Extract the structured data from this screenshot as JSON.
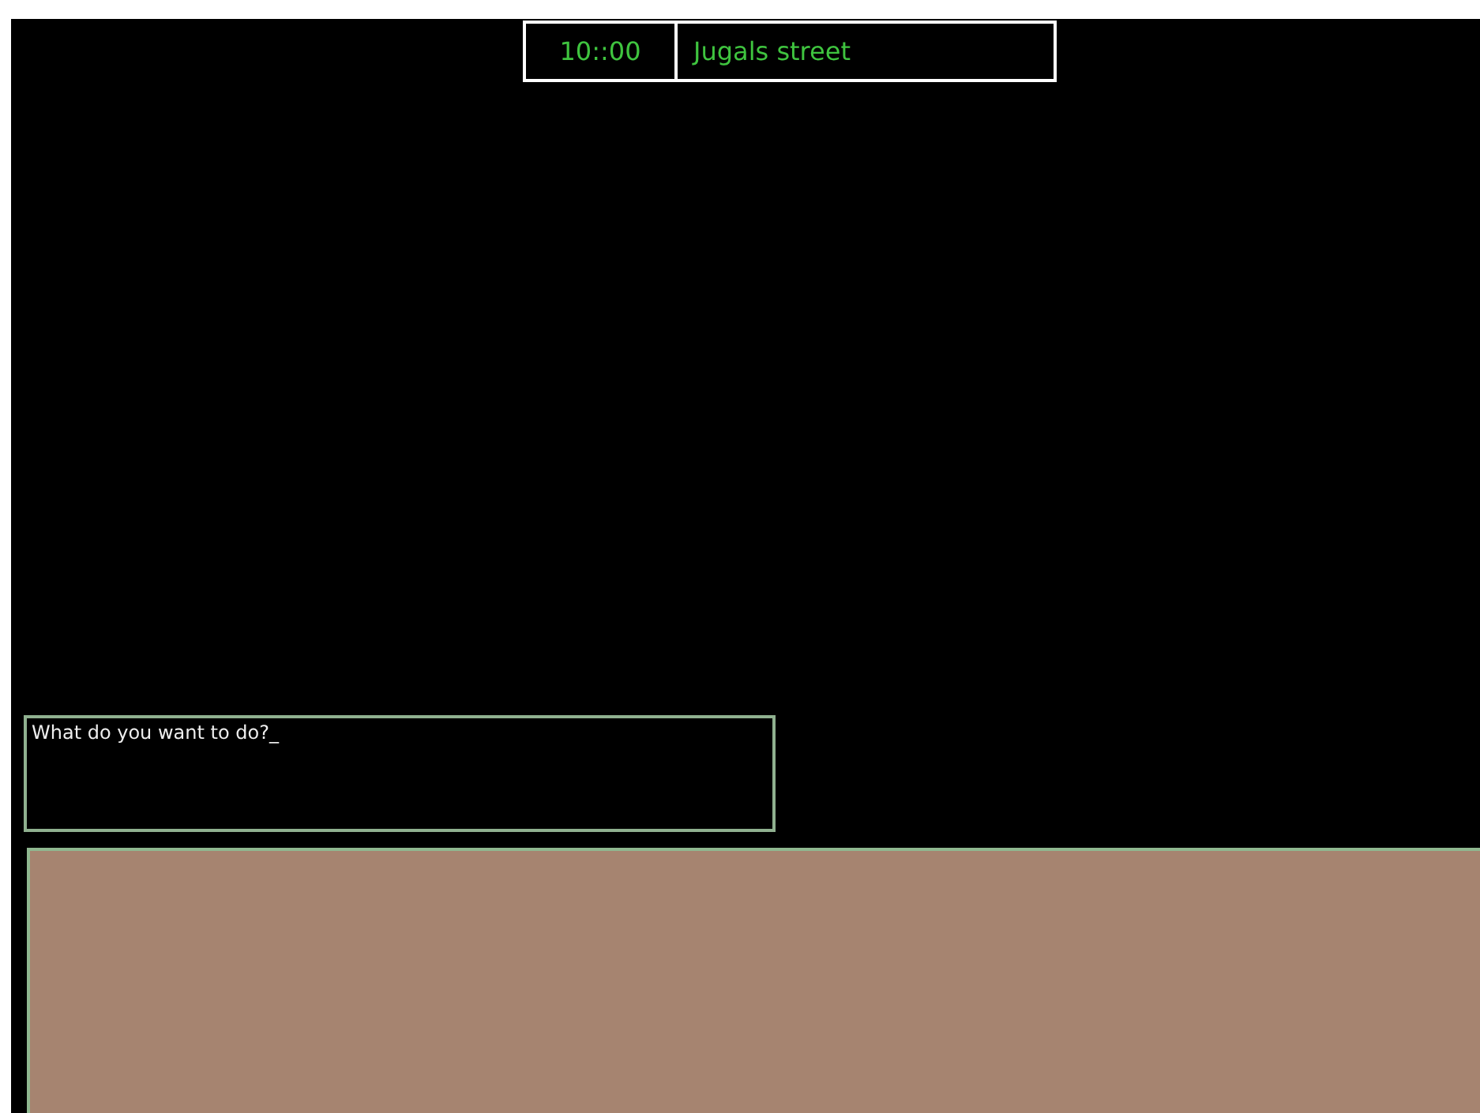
{
  "status_bar": {
    "time": "10::00",
    "location": "Jugals street"
  },
  "prompt": {
    "text": "What do you want to do?",
    "cursor": "_"
  },
  "scene_panel": {
    "kind": "empty"
  }
}
